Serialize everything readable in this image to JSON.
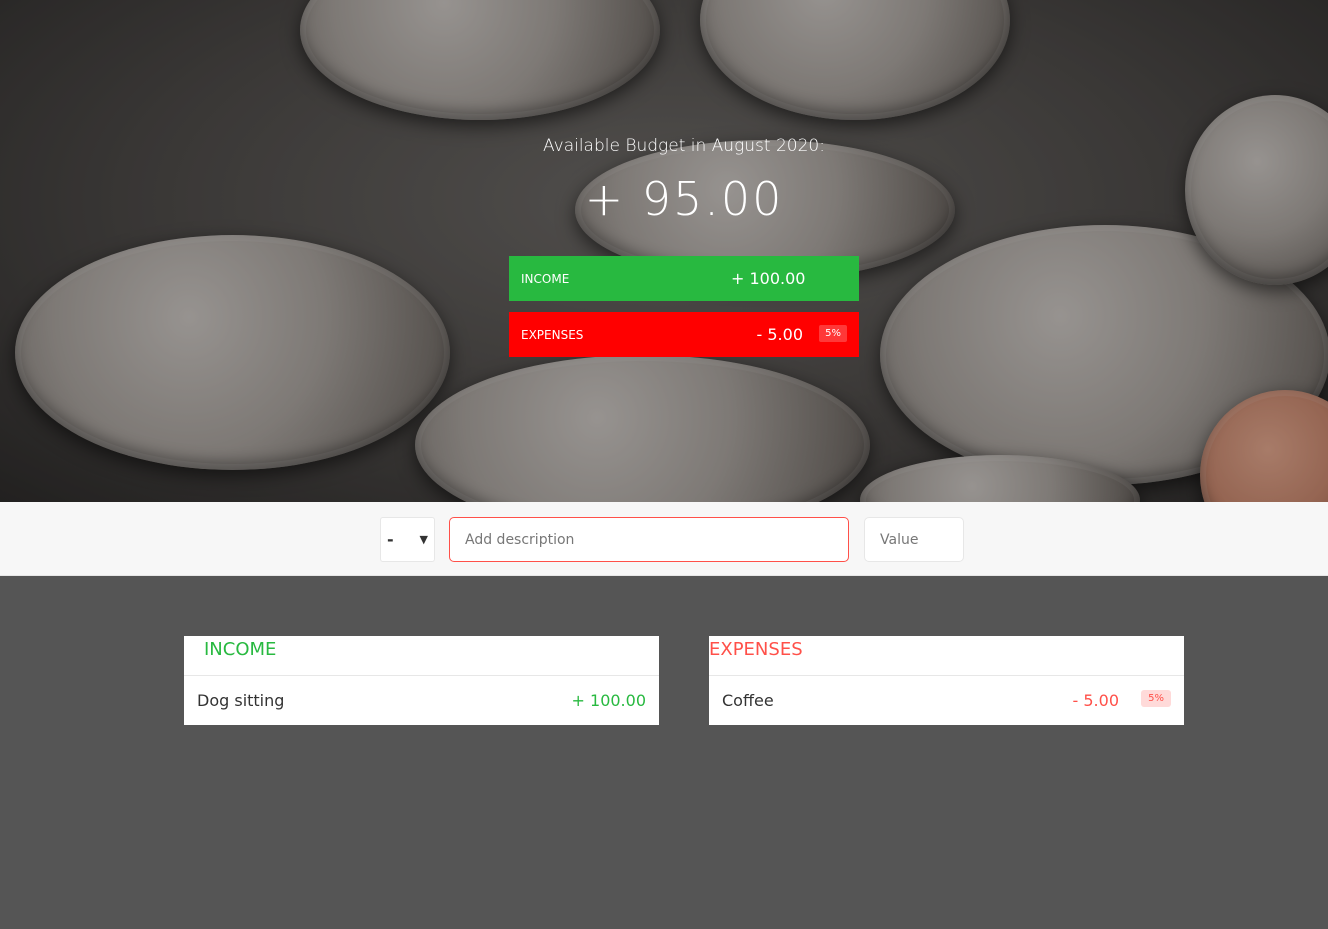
{
  "top": {
    "title": "Available Budget in August 2020:",
    "budget_value": "+ 95.00",
    "income": {
      "label": "Income",
      "value": "+ 100.00",
      "color": "#28b940"
    },
    "expenses": {
      "label": "Expenses",
      "value": "- 5.00",
      "percentage": "5%",
      "color": "#ff0000"
    }
  },
  "add": {
    "type_selected": "-",
    "description_placeholder": "Add description",
    "value_placeholder": "Value"
  },
  "income_list": {
    "title": "Income",
    "items": [
      {
        "description": "Dog sitting",
        "value": "+ 100.00"
      }
    ]
  },
  "expenses_list": {
    "title": "Expenses",
    "items": [
      {
        "description": "Coffee",
        "value": "- 5.00",
        "percentage": "5%"
      }
    ]
  },
  "colors": {
    "income": "#28b940",
    "expenses": "#ff5049",
    "background": "#555555"
  }
}
